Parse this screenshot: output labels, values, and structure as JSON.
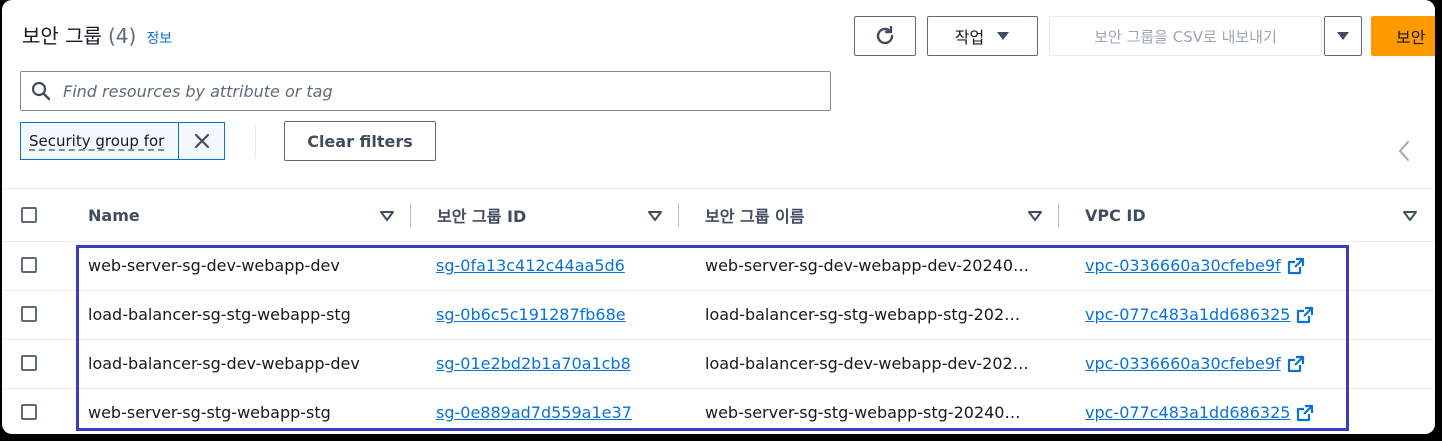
{
  "header": {
    "title": "보안 그룹",
    "count": "(4)",
    "info_link": "정보"
  },
  "toolbar": {
    "actions_label": "작업",
    "export_label": "보안 그룹을 CSV로 내보내기",
    "create_label": "보안"
  },
  "search": {
    "placeholder": "Find resources by attribute or tag",
    "value": ""
  },
  "filters": {
    "token_label": "Security group for",
    "clear_label": "Clear filters"
  },
  "table": {
    "columns": [
      "Name",
      "보안 그룹 ID",
      "보안 그룹 이름",
      "VPC ID"
    ],
    "rows": [
      {
        "name": "web-server-sg-dev-webapp-dev",
        "sg_id": "sg-0fa13c412c44aa5d6",
        "sg_name": "web-server-sg-dev-webapp-dev-20240…",
        "vpc_id": "vpc-0336660a30cfebe9f"
      },
      {
        "name": "load-balancer-sg-stg-webapp-stg",
        "sg_id": "sg-0b6c5c191287fb68e",
        "sg_name": "load-balancer-sg-stg-webapp-stg-202…",
        "vpc_id": "vpc-077c483a1dd686325"
      },
      {
        "name": "load-balancer-sg-dev-webapp-dev",
        "sg_id": "sg-01e2bd2b1a70a1cb8",
        "sg_name": "load-balancer-sg-dev-webapp-dev-202…",
        "vpc_id": "vpc-0336660a30cfebe9f"
      },
      {
        "name": "web-server-sg-stg-webapp-stg",
        "sg_id": "sg-0e889ad7d559a1e37",
        "sg_name": "web-server-sg-stg-webapp-stg-20240…",
        "vpc_id": "vpc-077c483a1dd686325"
      }
    ]
  },
  "icons": {
    "refresh": "refresh-icon",
    "caret": "caret-down-icon",
    "search": "search-icon",
    "close": "close-icon",
    "collapse": "chevron-left-icon",
    "sort": "sort-caret-icon",
    "external": "external-link-icon"
  },
  "colors": {
    "link": "#0972d3",
    "primary": "#ff9900",
    "highlight": "#3c3cbf"
  }
}
